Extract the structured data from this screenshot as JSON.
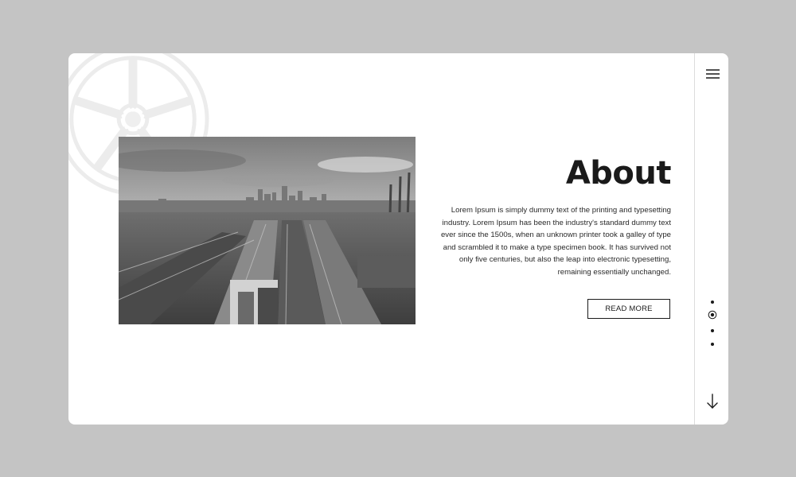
{
  "about": {
    "title": "About",
    "body": "Lorem Ipsum is simply dummy text of the printing and typesetting industry. Lorem Ipsum has been the industry's standard dummy text ever since the 1500s, when an unknown printer took a galley of type and scrambled it to make a type specimen book. It has survived not only five centuries, but also the leap into electronic typesetting, remaining essentially unchanged.",
    "button_label": "READ MORE"
  },
  "rail": {
    "menu_icon": "hamburger-menu-icon",
    "down_icon": "arrow-down-icon",
    "pagination_count": 4,
    "active_page": 2
  },
  "decor": {
    "background_icon": "wheel-rim-icon",
    "image": "city-port-photo-grayscale"
  },
  "colors": {
    "page_background": "#c4c4c4",
    "card_background": "#ffffff",
    "text": "#1a1a1a",
    "divider": "#dcdcdc"
  }
}
